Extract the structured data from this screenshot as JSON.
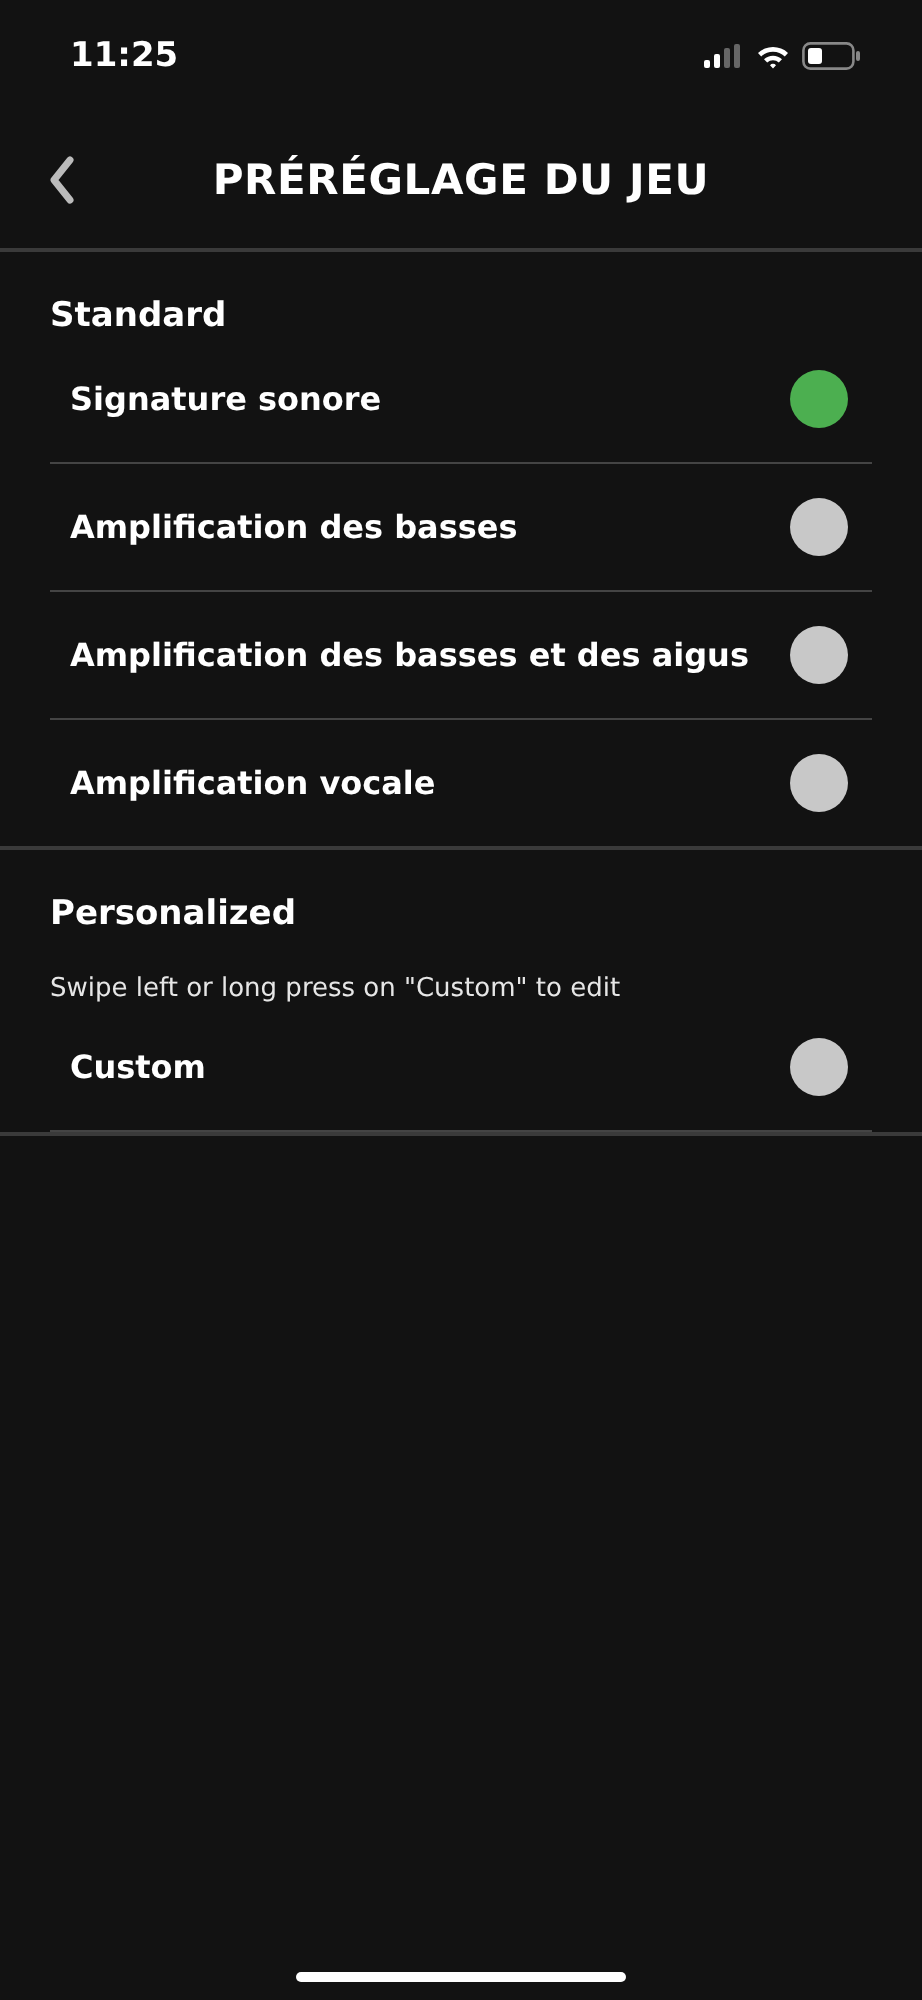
{
  "status_bar": {
    "time": "11:25"
  },
  "header": {
    "title": "PRÉRÉGLAGE DU JEU"
  },
  "sections": [
    {
      "title": "Standard",
      "items": [
        {
          "label": "Signature sonore",
          "selected": true
        },
        {
          "label": "Amplification des basses",
          "selected": false
        },
        {
          "label": "Amplification des basses et des aigus",
          "selected": false
        },
        {
          "label": "Amplification vocale",
          "selected": false
        }
      ]
    },
    {
      "title": "Personalized",
      "hint": "Swipe left or long press on \"Custom\" to edit",
      "items": [
        {
          "label": "Custom",
          "selected": false
        }
      ]
    }
  ]
}
